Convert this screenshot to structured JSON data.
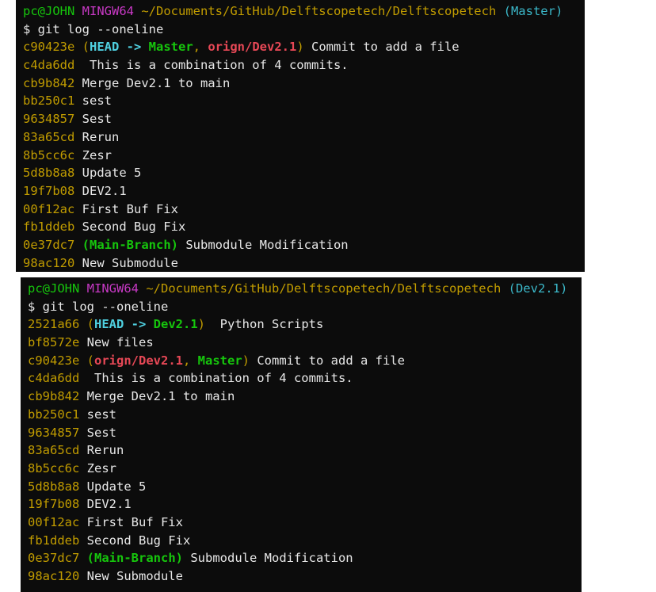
{
  "colors": {
    "background": "#0c0c0c",
    "text": "#e8e8e8",
    "user": "#16c60c",
    "mingw": "#c839c5",
    "path": "#c19c00",
    "branch": "#3bb8c9",
    "remote": "#e74856"
  },
  "terminal1": {
    "prompt": {
      "user": "pc@JOHN",
      "env": "MINGW64",
      "path": "~/Documents/GitHub/Delftscopetech/Delftscopetech",
      "branch": "(Master)"
    },
    "command": "$ git log --oneline",
    "head": {
      "hash": "c90423e",
      "open": "(",
      "head": "HEAD -> ",
      "branch": "Master",
      "sep": ", ",
      "remote": "orign/Dev2.1",
      "close": ")",
      "msg": " Commit to add a file"
    },
    "commits": [
      {
        "hash": "c4da6dd",
        "msg": "  This is a combination of 4 commits."
      },
      {
        "hash": "cb9b842",
        "msg": " Merge Dev2.1 to main"
      },
      {
        "hash": "bb250c1",
        "msg": " sest"
      },
      {
        "hash": "9634857",
        "msg": " Sest"
      },
      {
        "hash": "83a65cd",
        "msg": " Rerun"
      },
      {
        "hash": "8b5cc6c",
        "msg": " Zesr"
      },
      {
        "hash": "5d8b8a8",
        "msg": " Update 5"
      },
      {
        "hash": "19f7b08",
        "msg": " DEV2.1"
      },
      {
        "hash": "00f12ac",
        "msg": " First Buf Fix"
      },
      {
        "hash": "fb1ddeb",
        "msg": " Second Bug Fix"
      }
    ],
    "tagged": {
      "hash": "0e37dc7",
      "label": "(Main-Branch)",
      "msg": " Submodule Modification"
    },
    "last": {
      "hash": "98ac120",
      "msg": " New Submodule"
    }
  },
  "terminal2": {
    "prompt": {
      "user": "pc@JOHN",
      "env": "MINGW64",
      "path": "~/Documents/GitHub/Delftscopetech/Delftscopetech",
      "branch": "(Dev2.1)"
    },
    "command": "$ git log --oneline",
    "head": {
      "hash": "2521a66",
      "open": "(",
      "head": "HEAD -> ",
      "branch": "Dev2.1",
      "close": ")",
      "msg": "  Python Scripts"
    },
    "second": {
      "hash": "bf8572e",
      "msg": " New files"
    },
    "remote_line": {
      "hash": "c90423e",
      "open": "(",
      "remote": "orign/Dev2.1",
      "sep": ", ",
      "branch": "Master",
      "close": ")",
      "msg": " Commit to add a file"
    },
    "commits": [
      {
        "hash": "c4da6dd",
        "msg": "  This is a combination of 4 commits."
      },
      {
        "hash": "cb9b842",
        "msg": " Merge Dev2.1 to main"
      },
      {
        "hash": "bb250c1",
        "msg": " sest"
      },
      {
        "hash": "9634857",
        "msg": " Sest"
      },
      {
        "hash": "83a65cd",
        "msg": " Rerun"
      },
      {
        "hash": "8b5cc6c",
        "msg": " Zesr"
      },
      {
        "hash": "5d8b8a8",
        "msg": " Update 5"
      },
      {
        "hash": "19f7b08",
        "msg": " DEV2.1"
      },
      {
        "hash": "00f12ac",
        "msg": " First Buf Fix"
      },
      {
        "hash": "fb1ddeb",
        "msg": " Second Bug Fix"
      }
    ],
    "tagged": {
      "hash": "0e37dc7",
      "label": "(Main-Branch)",
      "msg": " Submodule Modification"
    },
    "last": {
      "hash": "98ac120",
      "msg": " New Submodule"
    }
  }
}
